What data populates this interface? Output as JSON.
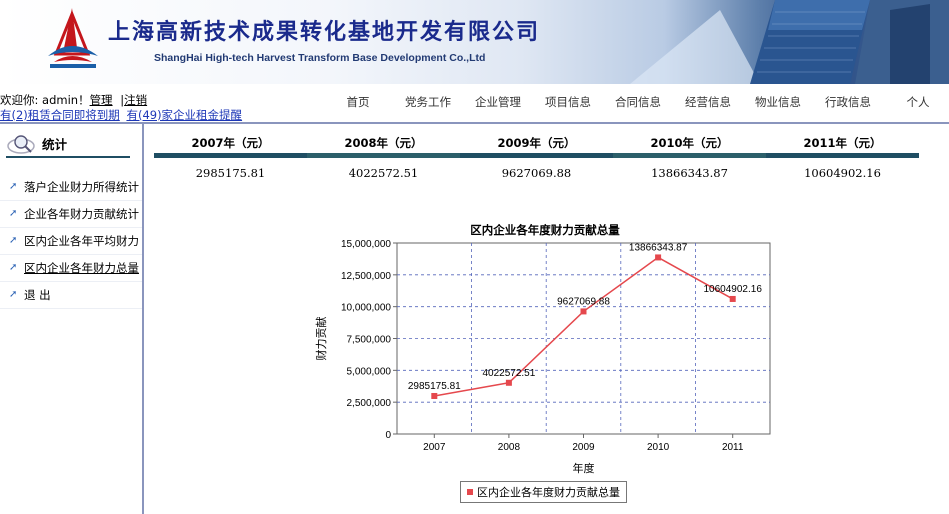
{
  "header": {
    "company_cn": "上海高新技术成果转化基地开发有限公司",
    "company_en": "ShangHai High-tech Harvest Transform Base Development Co.,Ltd"
  },
  "topbar": {
    "welcome_prefix": "欢迎你: admin！",
    "manage_link": "管理",
    "separator": "|",
    "logout_link": "注销",
    "alert_contracts": "有(2)租赁合同即将到期",
    "alert_rent": "有(49)家企业租金提醒"
  },
  "nav": [
    "首页",
    "党务工作",
    "企业管理",
    "项目信息",
    "合同信息",
    "经营信息",
    "物业信息",
    "行政信息",
    "个人"
  ],
  "sidebar": {
    "title": "统计",
    "items": [
      {
        "label": "落户企业财力所得统计",
        "active": false
      },
      {
        "label": "企业各年财力贡献统计",
        "active": false
      },
      {
        "label": "区内企业各年平均财力",
        "active": false
      },
      {
        "label": "区内企业各年财力总量",
        "active": true
      },
      {
        "label": "退  出",
        "active": false
      }
    ]
  },
  "stats": {
    "headers": [
      "2007年（元）",
      "2008年（元）",
      "2009年（元）",
      "2010年（元）",
      "2011年（元）"
    ],
    "values": [
      "2985175.81",
      "4022572.51",
      "9627069.88",
      "13866343.87",
      "10604902.16"
    ]
  },
  "chart_data": {
    "type": "line",
    "title": "区内企业各年度财力贡献总量",
    "xlabel": "年度",
    "ylabel": "财力贡献",
    "x": [
      "2007",
      "2008",
      "2009",
      "2010",
      "2011"
    ],
    "series": [
      {
        "name": "区内企业各年度财力贡献总量",
        "values": [
          2985175.81,
          4022572.51,
          9627069.88,
          13866343.87,
          10604902.16
        ],
        "labels": [
          "2985175.81",
          "4022572.51",
          "9627069.88",
          "13866343.87",
          "10604902.16"
        ]
      }
    ],
    "ylim": [
      0,
      15000000
    ],
    "yticks": [
      0,
      2500000,
      5000000,
      7500000,
      10000000,
      12500000,
      15000000
    ],
    "ytick_labels": [
      "0",
      "2,500,000",
      "5,000,000",
      "7,500,000",
      "10,000,000",
      "12,500,000",
      "15,000,000"
    ],
    "grid": true,
    "legend": "bottom",
    "line_color": "#e5484d",
    "grid_color": "#5566bb"
  }
}
